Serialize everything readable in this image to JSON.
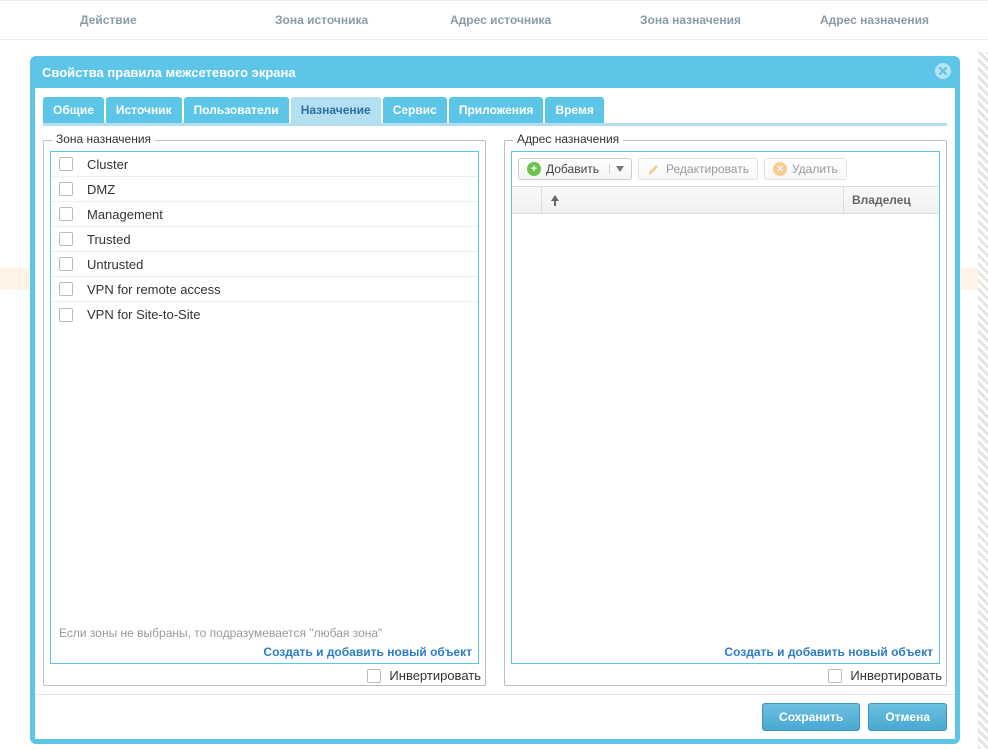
{
  "background": {
    "columns": [
      "Действие",
      "Зона источника",
      "Адрес источника",
      "Зона назначения",
      "Адрес назначения"
    ]
  },
  "modal": {
    "title": "Свойства правила межсетевого экрана",
    "tabs": [
      "Общие",
      "Источник",
      "Пользователи",
      "Назначение",
      "Сервис",
      "Приложения",
      "Время"
    ],
    "active_tab_index": 3,
    "zone_panel": {
      "legend": "Зона назначения",
      "items": [
        "Cluster",
        "DMZ",
        "Management",
        "Trusted",
        "Untrusted",
        "VPN for remote access",
        "VPN for Site-to-Site"
      ],
      "hint": "Если зоны не выбраны, то подразумевается \"любая зона\"",
      "create_link": "Создать и добавить новый объект",
      "invert_label": "Инвертировать"
    },
    "addr_panel": {
      "legend": "Адрес назначения",
      "toolbar": {
        "add": "Добавить",
        "edit": "Редактировать",
        "delete": "Удалить"
      },
      "columns": {
        "owner": "Владелец"
      },
      "create_link": "Создать и добавить новый объект",
      "invert_label": "Инвертировать"
    },
    "buttons": {
      "save": "Сохранить",
      "cancel": "Отмена"
    }
  }
}
